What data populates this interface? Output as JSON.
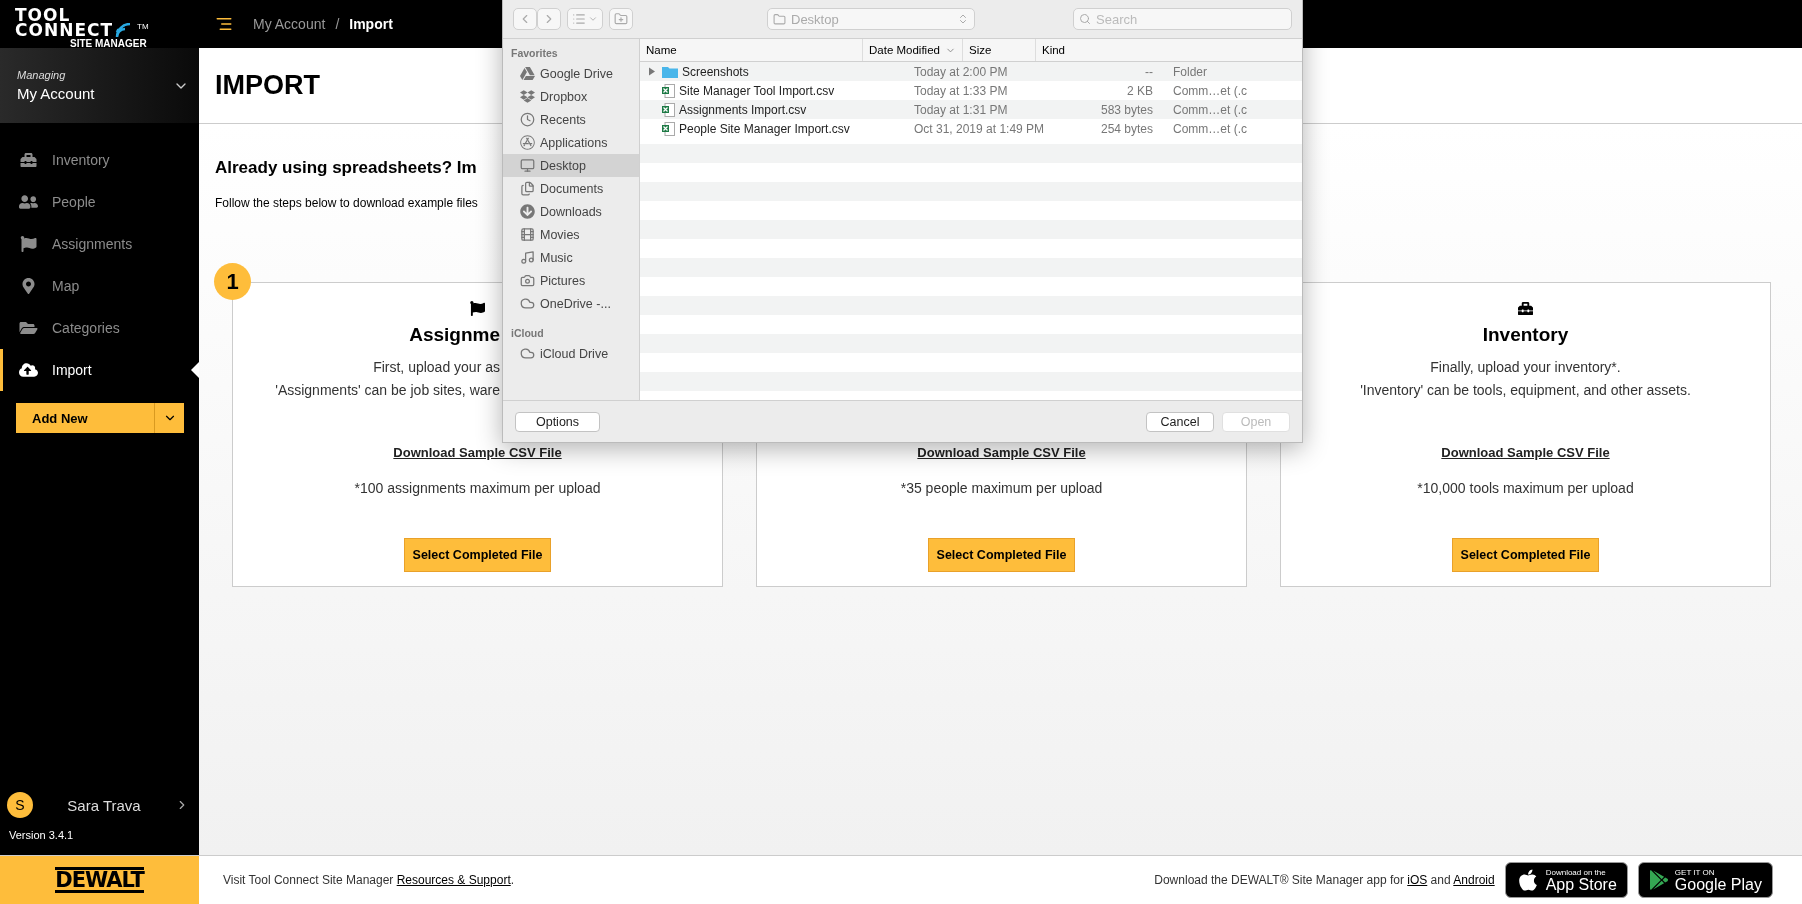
{
  "brand": {
    "line1": "TOOL",
    "line2": "CONNECT",
    "tm": "TM",
    "sub": "SITE MANAGER"
  },
  "breadcrumb": [
    {
      "label": "My Account",
      "selected": false
    },
    {
      "label": "Import",
      "selected": true
    }
  ],
  "breadcrumb_separator": "/",
  "account": {
    "caption": "Managing",
    "name": "My Account"
  },
  "nav": [
    {
      "label": "Inventory",
      "selected": false
    },
    {
      "label": "People",
      "selected": false
    },
    {
      "label": "Assignments",
      "selected": false
    },
    {
      "label": "Map",
      "selected": false
    },
    {
      "label": "Categories",
      "selected": false
    },
    {
      "label": "Import",
      "selected": true
    }
  ],
  "add_button": "Add New",
  "user": {
    "initial": "S",
    "name": "Sara Trava"
  },
  "version": "Version 3.4.1",
  "page_title": "IMPORT",
  "intro": {
    "heading": "Already using spreadsheets? Im",
    "text": "Follow the steps below to download example files"
  },
  "step_badge": "1",
  "cards": [
    {
      "title": "Assignme",
      "description": [
        "First, upload your as",
        "'Assignments' can be job sites, ware"
      ],
      "link": "Download Sample CSV File",
      "limit": "*100 assignments maximum per upload",
      "button": "Select Completed File"
    },
    {
      "link": "Download Sample CSV File",
      "limit": "*35 people maximum per upload",
      "button": "Select Completed File"
    },
    {
      "title": "Inventory",
      "description": [
        "Finally, upload your inventory*.",
        "'Inventory' can be tools, equipment, and other assets."
      ],
      "link": "Download Sample CSV File",
      "limit": "*10,000 tools maximum per upload",
      "button": "Select Completed File"
    }
  ],
  "dialog": {
    "location": "Desktop",
    "search": {
      "placeholder": "Search"
    },
    "sidebar": [
      {
        "section": "Favorites",
        "items": [
          {
            "label": "Google Drive",
            "selected": false
          },
          {
            "label": "Dropbox",
            "selected": false
          },
          {
            "label": "Recents",
            "selected": false
          },
          {
            "label": "Applications",
            "selected": false
          },
          {
            "label": "Desktop",
            "selected": true
          },
          {
            "label": "Documents",
            "selected": false
          },
          {
            "label": "Downloads",
            "selected": false
          },
          {
            "label": "Movies",
            "selected": false
          },
          {
            "label": "Music",
            "selected": false
          },
          {
            "label": "Pictures",
            "selected": false
          },
          {
            "label": "OneDrive -...",
            "selected": false
          }
        ]
      },
      {
        "section": "iCloud",
        "items": [
          {
            "label": "iCloud Drive",
            "selected": false
          }
        ]
      }
    ],
    "columns": [
      "Name",
      "Date Modified",
      "Size",
      "Kind"
    ],
    "rows": [
      {
        "kind": "folder",
        "name": "Screenshots",
        "date": "Today at 2:00 PM",
        "size": "--",
        "type": "Folder"
      },
      {
        "kind": "file",
        "name": "Site Manager Tool Import.csv",
        "date": "Today at 1:33 PM",
        "size": "2 KB",
        "type": "Comm…et (.c"
      },
      {
        "kind": "file",
        "name": "Assignments Import.csv",
        "date": "Today at 1:31 PM",
        "size": "583 bytes",
        "type": "Comm…et (.c"
      },
      {
        "kind": "file",
        "name": "People Site Manager Import.csv",
        "date": "Oct 31, 2019 at 1:49 PM",
        "size": "254 bytes",
        "type": "Comm…et (.c"
      }
    ],
    "buttons": [
      {
        "label": "Options",
        "disabled": false
      },
      {
        "label": "Cancel",
        "disabled": false
      },
      {
        "label": "Open",
        "disabled": true
      }
    ]
  },
  "footer": {
    "logo": "DEWALT",
    "visit": "Visit Tool Connect Site Manager ",
    "visit_link": "Resources & Support",
    "visit_end": ".",
    "app_text": "Download the DEWALT® Site Manager app for ",
    "ios": "iOS",
    "and": " and ",
    "android": "Android",
    "badges": [
      {
        "kind": "apple",
        "small": "Download on the",
        "big": "App Store"
      },
      {
        "kind": "google",
        "small": "GET IT ON",
        "big": "Google Play"
      }
    ]
  }
}
